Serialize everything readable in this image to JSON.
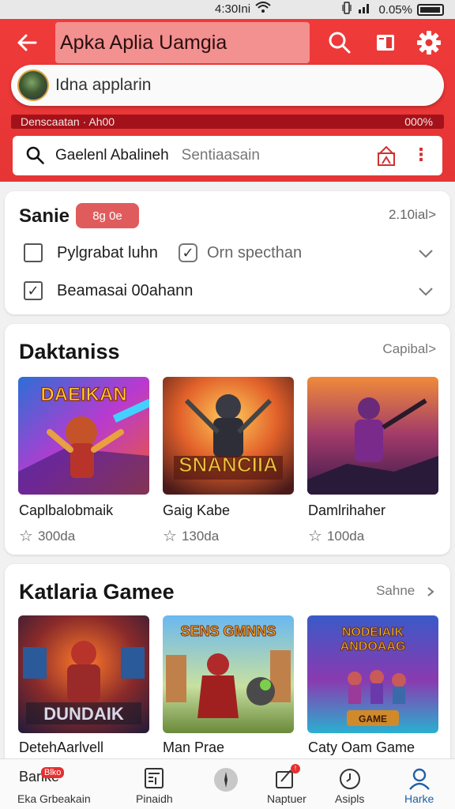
{
  "status_bar": {
    "time": "4:30Ini",
    "battery": "0.05%"
  },
  "header": {
    "title": "Apka Aplia Uamgia",
    "search_placeholder": "Idna applarin",
    "progress": {
      "left": "Denscaatan · Ah00",
      "right": "000%"
    },
    "filter": {
      "label": "Gaelenl  Abalineh",
      "hint": "Sentiaasain"
    }
  },
  "sort": {
    "title": "Sanie",
    "badge": "8g 0e",
    "more": "2.10ial>",
    "options": [
      {
        "label": "Pylgrabat luhn",
        "checked": false
      },
      {
        "label": "Orn specthan",
        "checked": true
      },
      {
        "label": "Beamasai  00ahann",
        "checked": true
      }
    ]
  },
  "sections": [
    {
      "title": "Daktaniss",
      "more": "Capibal>",
      "games": [
        {
          "name": "Caplbalobmaik",
          "rating": "300da",
          "art_text": "DAEIKAN"
        },
        {
          "name": "Gaig Kabe",
          "rating": "130da",
          "art_text": "SNANCIIA"
        },
        {
          "name": "Damlrihaher",
          "rating": "100da",
          "art_text": ""
        }
      ]
    },
    {
      "title": "Katlaria Gamee",
      "more": "Sahne",
      "games": [
        {
          "name": "DetehAarlvell",
          "art_text": "DUNDAIK"
        },
        {
          "name": "Man Prae",
          "art_text": "SENS GMNNS"
        },
        {
          "name": "Caty Oam Game",
          "art_text": "NODEIAIK ANDOAAG"
        }
      ]
    }
  ],
  "bottom_nav": [
    {
      "label": "Eka Grbeakain",
      "top_text": "Barlke",
      "badge": "Blko"
    },
    {
      "label": "Pinaidh"
    },
    {
      "label": ""
    },
    {
      "label": "Naptuer"
    },
    {
      "label": "Asipls"
    },
    {
      "label": "Harke"
    }
  ],
  "colors": {
    "accent": "#e53535",
    "active_nav": "#1f5fa6"
  }
}
